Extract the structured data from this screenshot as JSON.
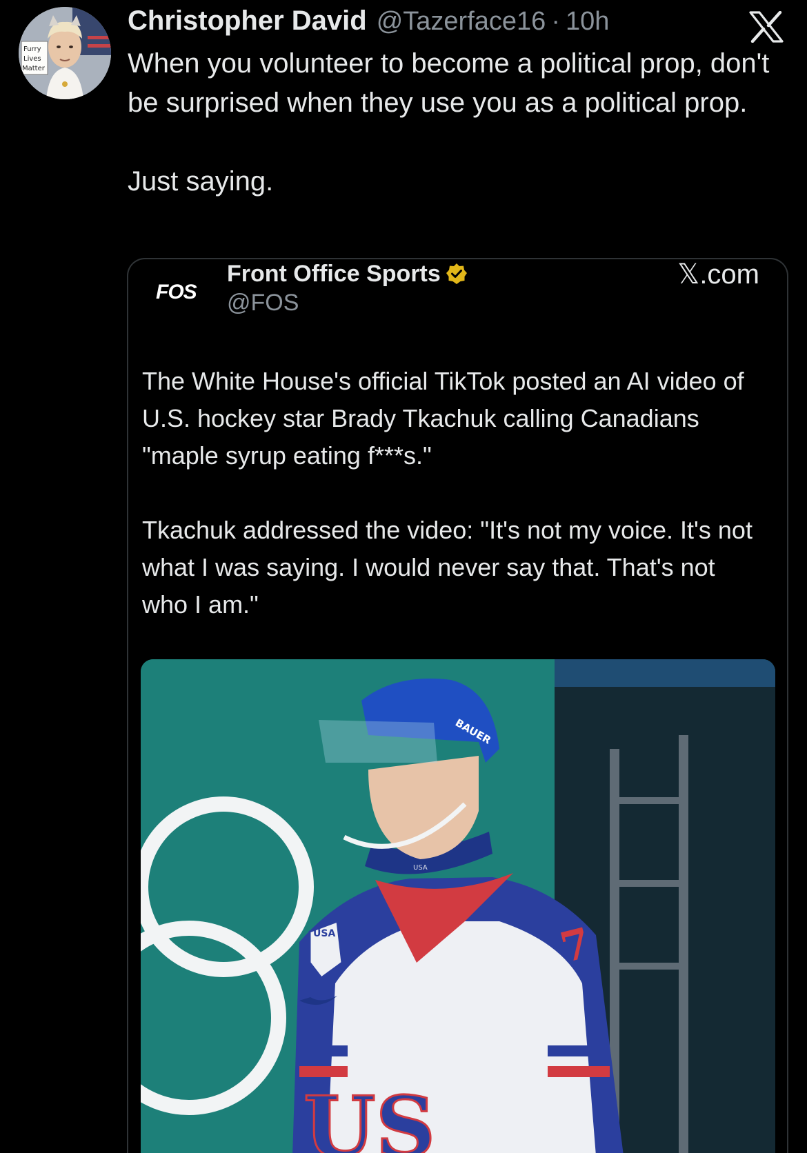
{
  "tweet": {
    "author_name": "Christopher David",
    "author_handle": "@Tazerface16",
    "separator": "·",
    "timestamp": "10h",
    "avatar_sign": [
      "Furry",
      "Lives",
      "Matter"
    ],
    "text_paragraphs": [
      "When you volunteer to become a political prop, don't be surprised when they use you as a political prop.",
      "Just saying."
    ]
  },
  "platform": {
    "logo_icon": "x-logo-icon"
  },
  "embed": {
    "logo_text": "FOS",
    "author_name": "Front Office Sports",
    "verified_icon": "verified-badge-icon",
    "verified_color": "#e2b719",
    "handle": "@FOS",
    "source": "𝕏.com",
    "text_paragraphs": [
      "The White House's official TikTok posted an AI video of U.S. hockey star Brady Tkachuk calling Canadians \"maple syrup eating f***s.\"",
      "Tkachuk addressed the video: \"It's not my voice. It's not what I was saying. I would never say that. That's not who I am.\""
    ],
    "photo": {
      "helmet_brand": "BAUER",
      "crest_text": "USA",
      "collar_text": "USA",
      "jersey_number": "7",
      "jersey_letters": "US",
      "colors": {
        "background": "#1d8079",
        "helmet": "#1f4fc2",
        "jersey_white": "#eef0f4",
        "jersey_blue": "#2b3f9e",
        "jersey_red": "#d23b41"
      }
    }
  }
}
